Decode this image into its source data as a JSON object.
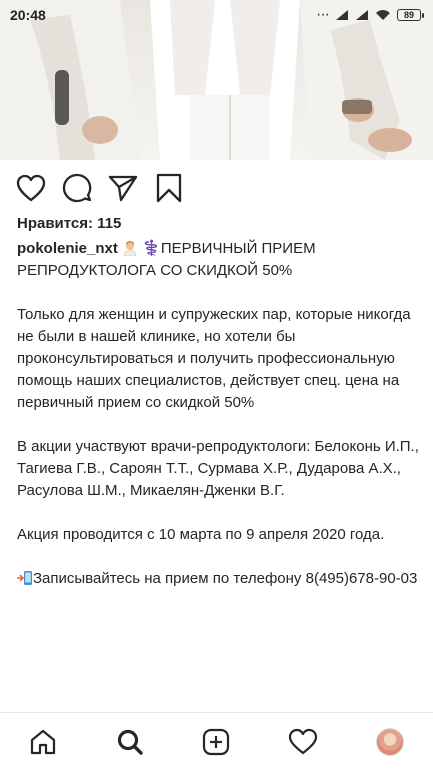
{
  "status_bar": {
    "time": "20:48",
    "battery": "89",
    "dots": "···",
    "icons": [
      "signal-icon",
      "signal-icon",
      "wifi-icon",
      "battery-icon"
    ]
  },
  "post": {
    "likes": "Нравится: 115",
    "username": "pokolenie_nxt",
    "caption_head": "⚕️ПЕРВИЧНЫЙ ПРИЕМ РЕПРОДУКТОЛОГА СО СКИДКОЙ 50%",
    "paragraph_1": "Только для женщин и супружеских пар, которые никогда не были в нашей клинике, но хотели бы проконсультироваться и получить профессиональную помощь наших специалистов, действует спец. цена на первичный прием со скидкой 50%",
    "paragraph_2": "В акции участвуют врачи-репродуктологи: Белоконь И.П., Тагиева Г.В., Сароян Т.Т., Сурмава Х.Р., Дударова А.Х., Расулова Ш.М., Микаелян-Дженки В.Г.",
    "paragraph_3": "Акция проводится с 10 марта по 9 апреля 2020 года.",
    "paragraph_4": "Записывайтесь на прием по телефону 8(495)678-90-03"
  },
  "actions": [
    "heart-icon",
    "comment-icon",
    "share-icon",
    "bookmark-icon"
  ],
  "bottom_nav": [
    "home-icon",
    "search-icon",
    "new-post-icon",
    "activity-icon",
    "profile-avatar"
  ]
}
